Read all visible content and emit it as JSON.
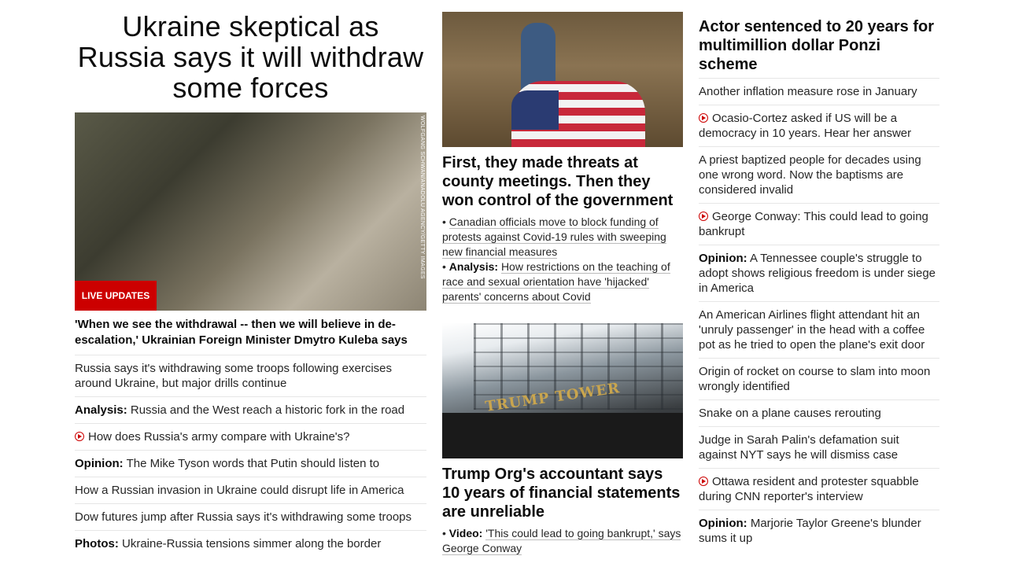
{
  "column1": {
    "headline": "Ukraine skeptical as Russia says it will withdraw some forces",
    "image_badge": "LIVE UPDATES",
    "photo_credit": "WOLFGANG SCHWAN/ANADOLU AGENCY/GETTY IMAGES",
    "subheadline": "'When we see the withdrawal -- then we will believe in de-escalation,' Ukrainian Foreign Minister Dmytro Kuleba says",
    "items": [
      {
        "label": "",
        "text": "Russia says it's withdrawing some troops following exercises around Ukraine, but major drills continue"
      },
      {
        "label": "Analysis:",
        "text": "Russia and the West reach a historic fork in the road"
      },
      {
        "label": "",
        "text": "How does Russia's army compare with Ukraine's?"
      },
      {
        "label": "Opinion:",
        "text": "The Mike Tyson words that Putin should listen to"
      },
      {
        "label": "",
        "text": "How a Russian invasion in Ukraine could disrupt life in America"
      },
      {
        "label": "",
        "text": "Dow futures jump after Russia says it's withdrawing some troops"
      },
      {
        "label": "Photos:",
        "text": "Ukraine-Russia tensions simmer along the border"
      }
    ]
  },
  "column2": {
    "story1": {
      "headline": "First, they made threats at county meetings. Then they won control of the government",
      "bullets": [
        {
          "label": "",
          "text": "Canadian officials move to block funding of protests against Covid-19 rules with sweeping new financial measures"
        },
        {
          "label": "Analysis:",
          "text": "How restrictions on the teaching of race and sexual orientation have 'hijacked' parents' concerns about Covid"
        }
      ]
    },
    "story2": {
      "image_sign": "TRUMP TOWER",
      "headline": "Trump Org's accountant says 10 years of financial statements are unreliable",
      "bullets": [
        {
          "label": "Video:",
          "text": "'This could lead to going bankrupt,' says George Conway"
        }
      ]
    }
  },
  "column3": {
    "headline": "Actor sentenced to 20 years for multimillion dollar Ponzi scheme",
    "items": [
      {
        "label": "",
        "text": "Another inflation measure rose in January"
      },
      {
        "label": "",
        "text": "Ocasio-Cortez asked if US will be a democracy in 10 years. Hear her answer"
      },
      {
        "label": "",
        "text": "A priest baptized people for decades using one wrong word. Now the baptisms are considered invalid"
      },
      {
        "label": "",
        "text": "George Conway: This could lead to going bankrupt"
      },
      {
        "label": "Opinion:",
        "text": "A Tennessee couple's struggle to adopt shows religious freedom is under siege in America"
      },
      {
        "label": "",
        "text": "An American Airlines flight attendant hit an 'unruly passenger' in the head with a coffee pot as he tried to open the plane's exit door"
      },
      {
        "label": "",
        "text": "Origin of rocket on course to slam into moon wrongly identified"
      },
      {
        "label": "",
        "text": "Snake on a plane causes rerouting"
      },
      {
        "label": "",
        "text": "Judge in Sarah Palin's defamation suit against NYT says he will dismiss case"
      },
      {
        "label": "",
        "text": "Ottawa resident and protester squabble during CNN reporter's interview"
      },
      {
        "label": "Opinion:",
        "text": "Marjorie Taylor Greene's blunder sums it up"
      }
    ]
  },
  "icons": {
    "video": "play-circle-icon",
    "accent": "#cc0000"
  }
}
